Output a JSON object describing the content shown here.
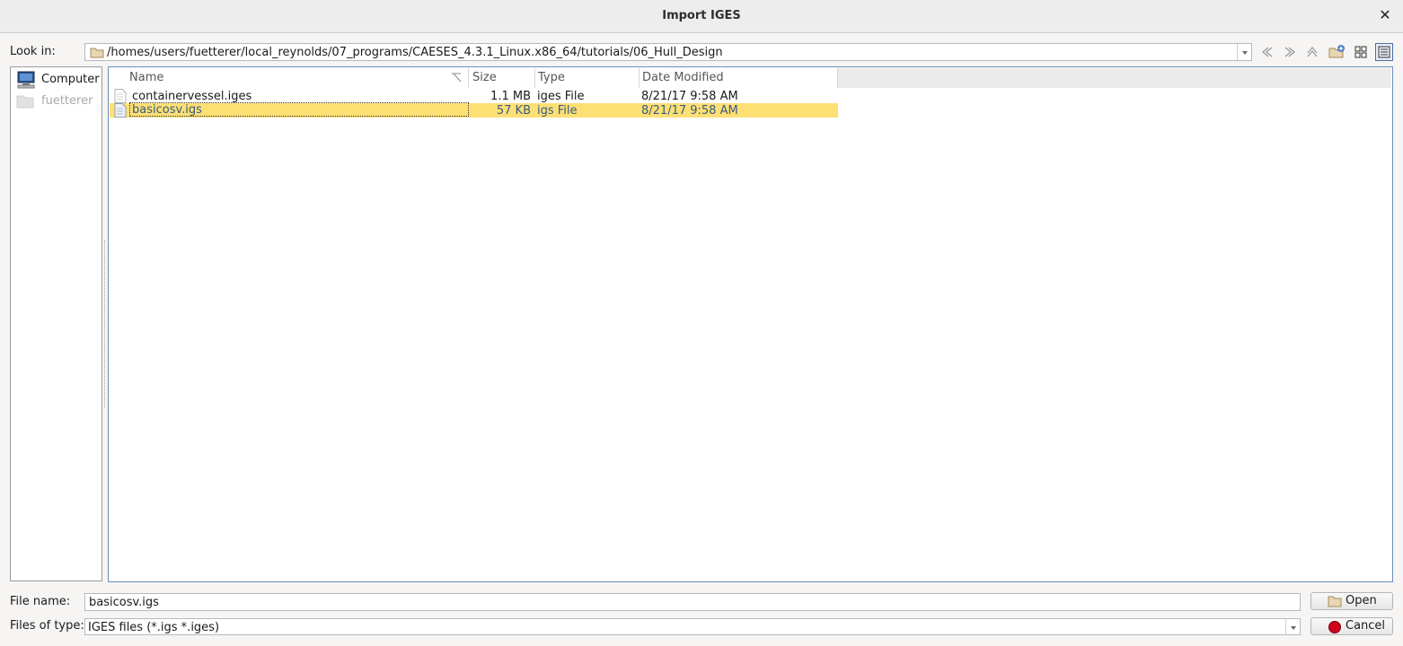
{
  "window": {
    "title": "Import IGES",
    "close_icon": "close-icon"
  },
  "look_in": {
    "label": "Look in:",
    "path": "/homes/users/fuetterer/local_reynolds/07_programs/CAESES_4.3.1_Linux.x86_64/tutorials/06_Hull_Design",
    "toolbar_icons": [
      "back-icon",
      "forward-icon",
      "parent-directory-icon",
      "new-folder-icon",
      "list-view-icon",
      "detail-view-icon"
    ]
  },
  "sidebar": {
    "items": [
      {
        "label": "Computer",
        "icon": "computer-icon",
        "enabled": true
      },
      {
        "label": "fuetterer",
        "icon": "folder-icon",
        "enabled": false
      }
    ]
  },
  "file_list": {
    "columns": [
      "Name",
      "Size",
      "Type",
      "Date Modified"
    ],
    "rows": [
      {
        "name": "containervessel.iges",
        "size": "1.1 MB",
        "type": "iges File",
        "date": "8/21/17 9:58 AM",
        "selected": false
      },
      {
        "name": "basicosv.igs",
        "size": "57 KB",
        "type": "igs File",
        "date": "8/21/17 9:58 AM",
        "selected": true
      }
    ]
  },
  "file_name": {
    "label": "File name:",
    "value": "basicosv.igs"
  },
  "files_of_type": {
    "label": "Files of type:",
    "value": "IGES files (*.igs *.iges)"
  },
  "buttons": {
    "open": "Open",
    "cancel": "Cancel"
  },
  "colors": {
    "selection": "#fde073",
    "selected_text": "#3b5a86",
    "focus_border": "#6b8db8",
    "cancel_icon": "#d0021b"
  }
}
